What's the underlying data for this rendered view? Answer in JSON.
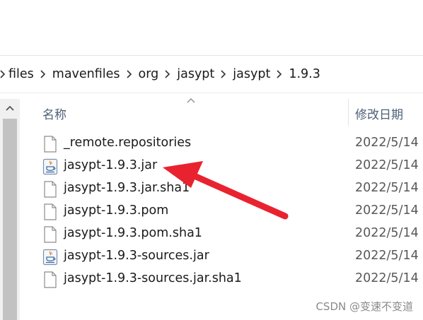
{
  "breadcrumb": {
    "items": [
      "files",
      "mavenfiles",
      "org",
      "jasypt",
      "jasypt",
      "1.9.3"
    ]
  },
  "columns": {
    "name": "名称",
    "modified": "修改日期"
  },
  "files": [
    {
      "name": "_remote.repositories",
      "date": "2022/5/14",
      "icon": "blank-file-icon"
    },
    {
      "name": "jasypt-1.9.3.jar",
      "date": "2022/5/14",
      "icon": "java-jar-icon"
    },
    {
      "name": "jasypt-1.9.3.jar.sha1",
      "date": "2022/5/14",
      "icon": "blank-file-icon"
    },
    {
      "name": "jasypt-1.9.3.pom",
      "date": "2022/5/14",
      "icon": "blank-file-icon"
    },
    {
      "name": "jasypt-1.9.3.pom.sha1",
      "date": "2022/5/14",
      "icon": "blank-file-icon"
    },
    {
      "name": "jasypt-1.9.3-sources.jar",
      "date": "2022/5/14",
      "icon": "java-jar-icon"
    },
    {
      "name": "jasypt-1.9.3-sources.jar.sha1",
      "date": "2022/5/14",
      "icon": "blank-file-icon"
    }
  ],
  "watermark": "CSDN @变速不变道",
  "colors": {
    "arrow": "#e8232f",
    "header_text": "#4c607a",
    "scroll_thumb": "#c2c2c2"
  }
}
